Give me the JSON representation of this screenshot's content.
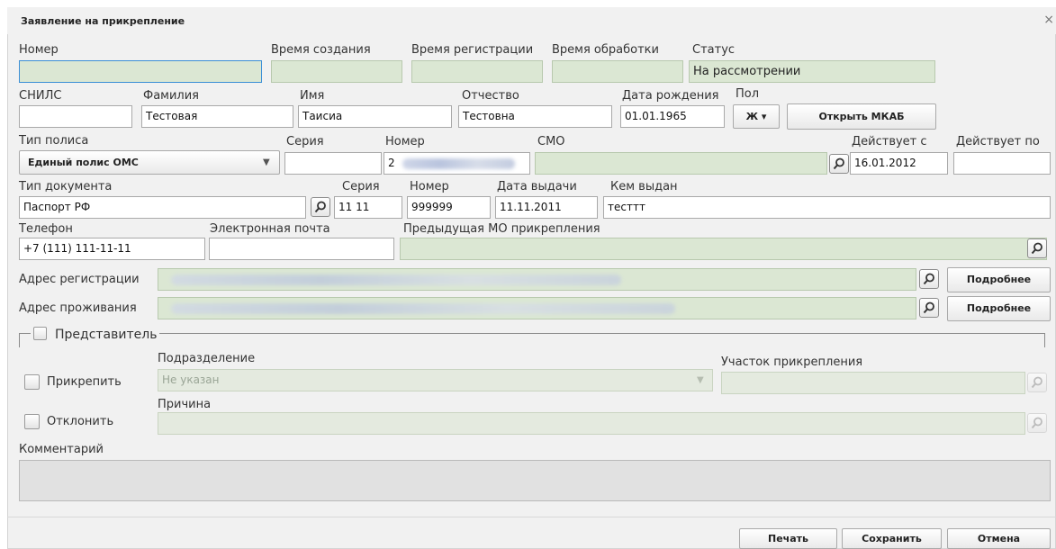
{
  "dialog": {
    "title": "Заявление на прикрепление",
    "close": "×"
  },
  "header": {
    "number_label": "Номер",
    "created_label": "Время создания",
    "registered_label": "Время регистрации",
    "processed_label": "Время обработки",
    "status_label": "Статус",
    "status_value": "На рассмотрении"
  },
  "person": {
    "snils_label": "СНИЛС",
    "last_name_label": "Фамилия",
    "last_name": "Тестовая",
    "first_name_label": "Имя",
    "first_name": "Таисиа",
    "patronymic_label": "Отчество",
    "patronymic": "Тестовна",
    "birth_date_label": "Дата рождения",
    "birth_date": "01.01.1965",
    "sex_label": "Пол",
    "sex_value": "Ж",
    "open_mkab": "Открыть МКАБ"
  },
  "policy": {
    "type_label": "Тип полиса",
    "type_value": "Единый полис ОМС",
    "series_label": "Серия",
    "number_label": "Номер",
    "number_prefix": "2",
    "smo_label": "СМО",
    "valid_from_label": "Действует с",
    "valid_from": "16.01.2012",
    "valid_to_label": "Действует по"
  },
  "document": {
    "type_label": "Тип документа",
    "type_value": "Паспорт РФ",
    "series_label": "Серия",
    "series": "11 11",
    "number_label": "Номер",
    "number": "999999",
    "issue_date_label": "Дата выдачи",
    "issue_date": "11.11.2011",
    "issued_by_label": "Кем выдан",
    "issued_by": "тесттт"
  },
  "contacts": {
    "phone_label": "Телефон",
    "phone": "+7 (111) 111-11-11",
    "email_label": "Электронная почта",
    "prev_mo_label": "Предыдущая МО прикрепления"
  },
  "address": {
    "registration_label": "Адрес регистрации",
    "residence_label": "Адрес проживания",
    "details_button": "Подробнее"
  },
  "representative": {
    "label": "Представитель"
  },
  "attach": {
    "attach_label": "Прикрепить",
    "department_label": "Подразделение",
    "department_value": "Не указан",
    "area_label": "Участок прикрепления",
    "reject_label": "Отклонить",
    "reason_label": "Причина"
  },
  "comment": {
    "label": "Комментарий"
  },
  "footer": {
    "print": "Печать",
    "save": "Сохранить",
    "cancel": "Отмена"
  }
}
